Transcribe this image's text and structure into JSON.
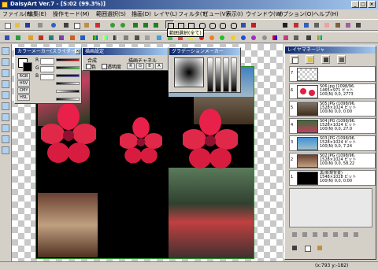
{
  "window": {
    "title": "DaisyArt Ver.7 - [S:02 (99.3%)]"
  },
  "menu": [
    "ファイル(F)",
    "編集(E)",
    "操作モード(M)",
    "範囲選択(S)",
    "描画(D)",
    "レイヤ(L)",
    "フィルタ(T)",
    "ビュー(V)",
    "表示(I)",
    "ウインドウ(W)",
    "オプション(O)",
    "ヘルプ(H)"
  ],
  "tooltip": "範囲選択(全て)",
  "color_panel": {
    "title": "カラーメーカー(スライダー)",
    "labels": [
      "RGB",
      "HSV",
      "CMY",
      "HSL"
    ],
    "channels": [
      "R",
      "G",
      "B"
    ]
  },
  "blend_panel": {
    "title": "描画設定",
    "label_mode": "合成",
    "check_color": "色",
    "check_transparent": "透明度",
    "channel_label": "描画チャネル",
    "channels": [
      "R",
      "G",
      "B",
      "A"
    ]
  },
  "gradient_panel": {
    "title": "グラデーションメーカー"
  },
  "layer_manager": {
    "title": "レイヤマネージャ",
    "layers": [
      {
        "num": "7",
        "text": ""
      },
      {
        "num": "6",
        "text": "S06.jpg (1098/96.\n1465×971 ビット\n100(N) 0,0, 2773"
      },
      {
        "num": "5",
        "text": "S05.JPG (1098/96.\n1528×1024 ビット\n100(N) 0,0, 0.00"
      },
      {
        "num": "4",
        "text": "S04.JPG (1098/96.\n1528×1024 ビット\n100(N) 0,0, 27.0"
      },
      {
        "num": "3",
        "text": "S03.JPG (1098/96.\n1528×1024 ビット\n100(N) 0,0, 7.24"
      },
      {
        "num": "2",
        "text": "S02.JPG (1098/96.\n1528×1024 ビット\n100(N) 0,0, 58.22"
      },
      {
        "num": "1",
        "text": "黒(新規背景)\n1548×1028 ビット\n100(N) 0,0, 0.00"
      }
    ]
  },
  "status": {
    "position": "(x:793 y:-182)"
  }
}
